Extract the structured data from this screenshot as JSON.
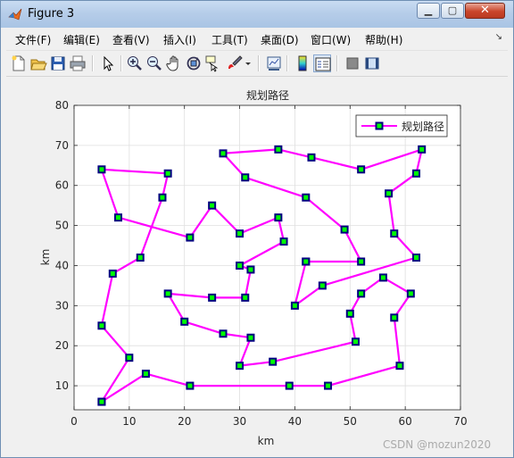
{
  "window": {
    "title": "Figure 3"
  },
  "menu": [
    {
      "label": "文件(F)",
      "name": "menu-file"
    },
    {
      "label": "编辑(E)",
      "name": "menu-edit"
    },
    {
      "label": "查看(V)",
      "name": "menu-view"
    },
    {
      "label": "插入(I)",
      "name": "menu-insert"
    },
    {
      "label": "工具(T)",
      "name": "menu-tools"
    },
    {
      "label": "桌面(D)",
      "name": "menu-desktop"
    },
    {
      "label": "窗口(W)",
      "name": "menu-window"
    },
    {
      "label": "帮助(H)",
      "name": "menu-help"
    }
  ],
  "toolbar": [
    "new-figure-icon",
    "open-file-icon",
    "save-icon",
    "print-icon",
    "pointer-icon",
    "zoom-in-icon",
    "zoom-out-icon",
    "pan-hand-icon",
    "rotate-3d-icon",
    "data-cursor-icon",
    "brush-icon",
    "brush-dropdown-icon",
    "link-plot-icon",
    "colorbar-icon",
    "legend-icon",
    "hide-plot-tools-icon",
    "show-plot-tools-icon"
  ],
  "watermark": "CSDN @mozun2020",
  "chart_data": {
    "type": "line",
    "title": "规划路径",
    "xlabel": "km",
    "ylabel": "km",
    "xlim": [
      0,
      70
    ],
    "ylim": [
      4,
      80
    ],
    "xticks": [
      0,
      10,
      20,
      30,
      40,
      50,
      60,
      70
    ],
    "yticks": [
      10,
      20,
      30,
      40,
      50,
      60,
      70,
      80
    ],
    "grid": true,
    "legend": "top-right",
    "line_color": "#ff00ff",
    "marker_face": "#00ff00",
    "marker_edge": "#000080",
    "series": [
      {
        "name": "规划路径",
        "points": [
          [
            5,
            6
          ],
          [
            13,
            13
          ],
          [
            21,
            10
          ],
          [
            39,
            10
          ],
          [
            46,
            10
          ],
          [
            59,
            15
          ],
          [
            58,
            27
          ],
          [
            61,
            33
          ],
          [
            56,
            37
          ],
          [
            52,
            33
          ],
          [
            50,
            28
          ],
          [
            51,
            21
          ],
          [
            36,
            16
          ],
          [
            30,
            15
          ],
          [
            32,
            22
          ],
          [
            27,
            23
          ],
          [
            20,
            26
          ],
          [
            17,
            33
          ],
          [
            25,
            32
          ],
          [
            31,
            32
          ],
          [
            32,
            39
          ],
          [
            30,
            40
          ],
          [
            38,
            46
          ],
          [
            37,
            52
          ],
          [
            30,
            48
          ],
          [
            25,
            55
          ],
          [
            21,
            47
          ],
          [
            8,
            52
          ],
          [
            5,
            64
          ],
          [
            17,
            63
          ],
          [
            16,
            57
          ],
          [
            12,
            42
          ],
          [
            7,
            38
          ],
          [
            5,
            25
          ],
          [
            10,
            17
          ],
          [
            5,
            6
          ]
        ]
      },
      {
        "name": "规划路径",
        "points": [
          [
            42,
            41
          ],
          [
            52,
            41
          ],
          [
            49,
            49
          ],
          [
            42,
            57
          ],
          [
            31,
            62
          ],
          [
            27,
            68
          ],
          [
            37,
            69
          ],
          [
            43,
            67
          ],
          [
            52,
            64
          ],
          [
            63,
            69
          ],
          [
            62,
            63
          ],
          [
            57,
            58
          ],
          [
            58,
            48
          ],
          [
            62,
            42
          ],
          [
            45,
            35
          ],
          [
            40,
            30
          ],
          [
            42,
            41
          ]
        ]
      }
    ]
  }
}
